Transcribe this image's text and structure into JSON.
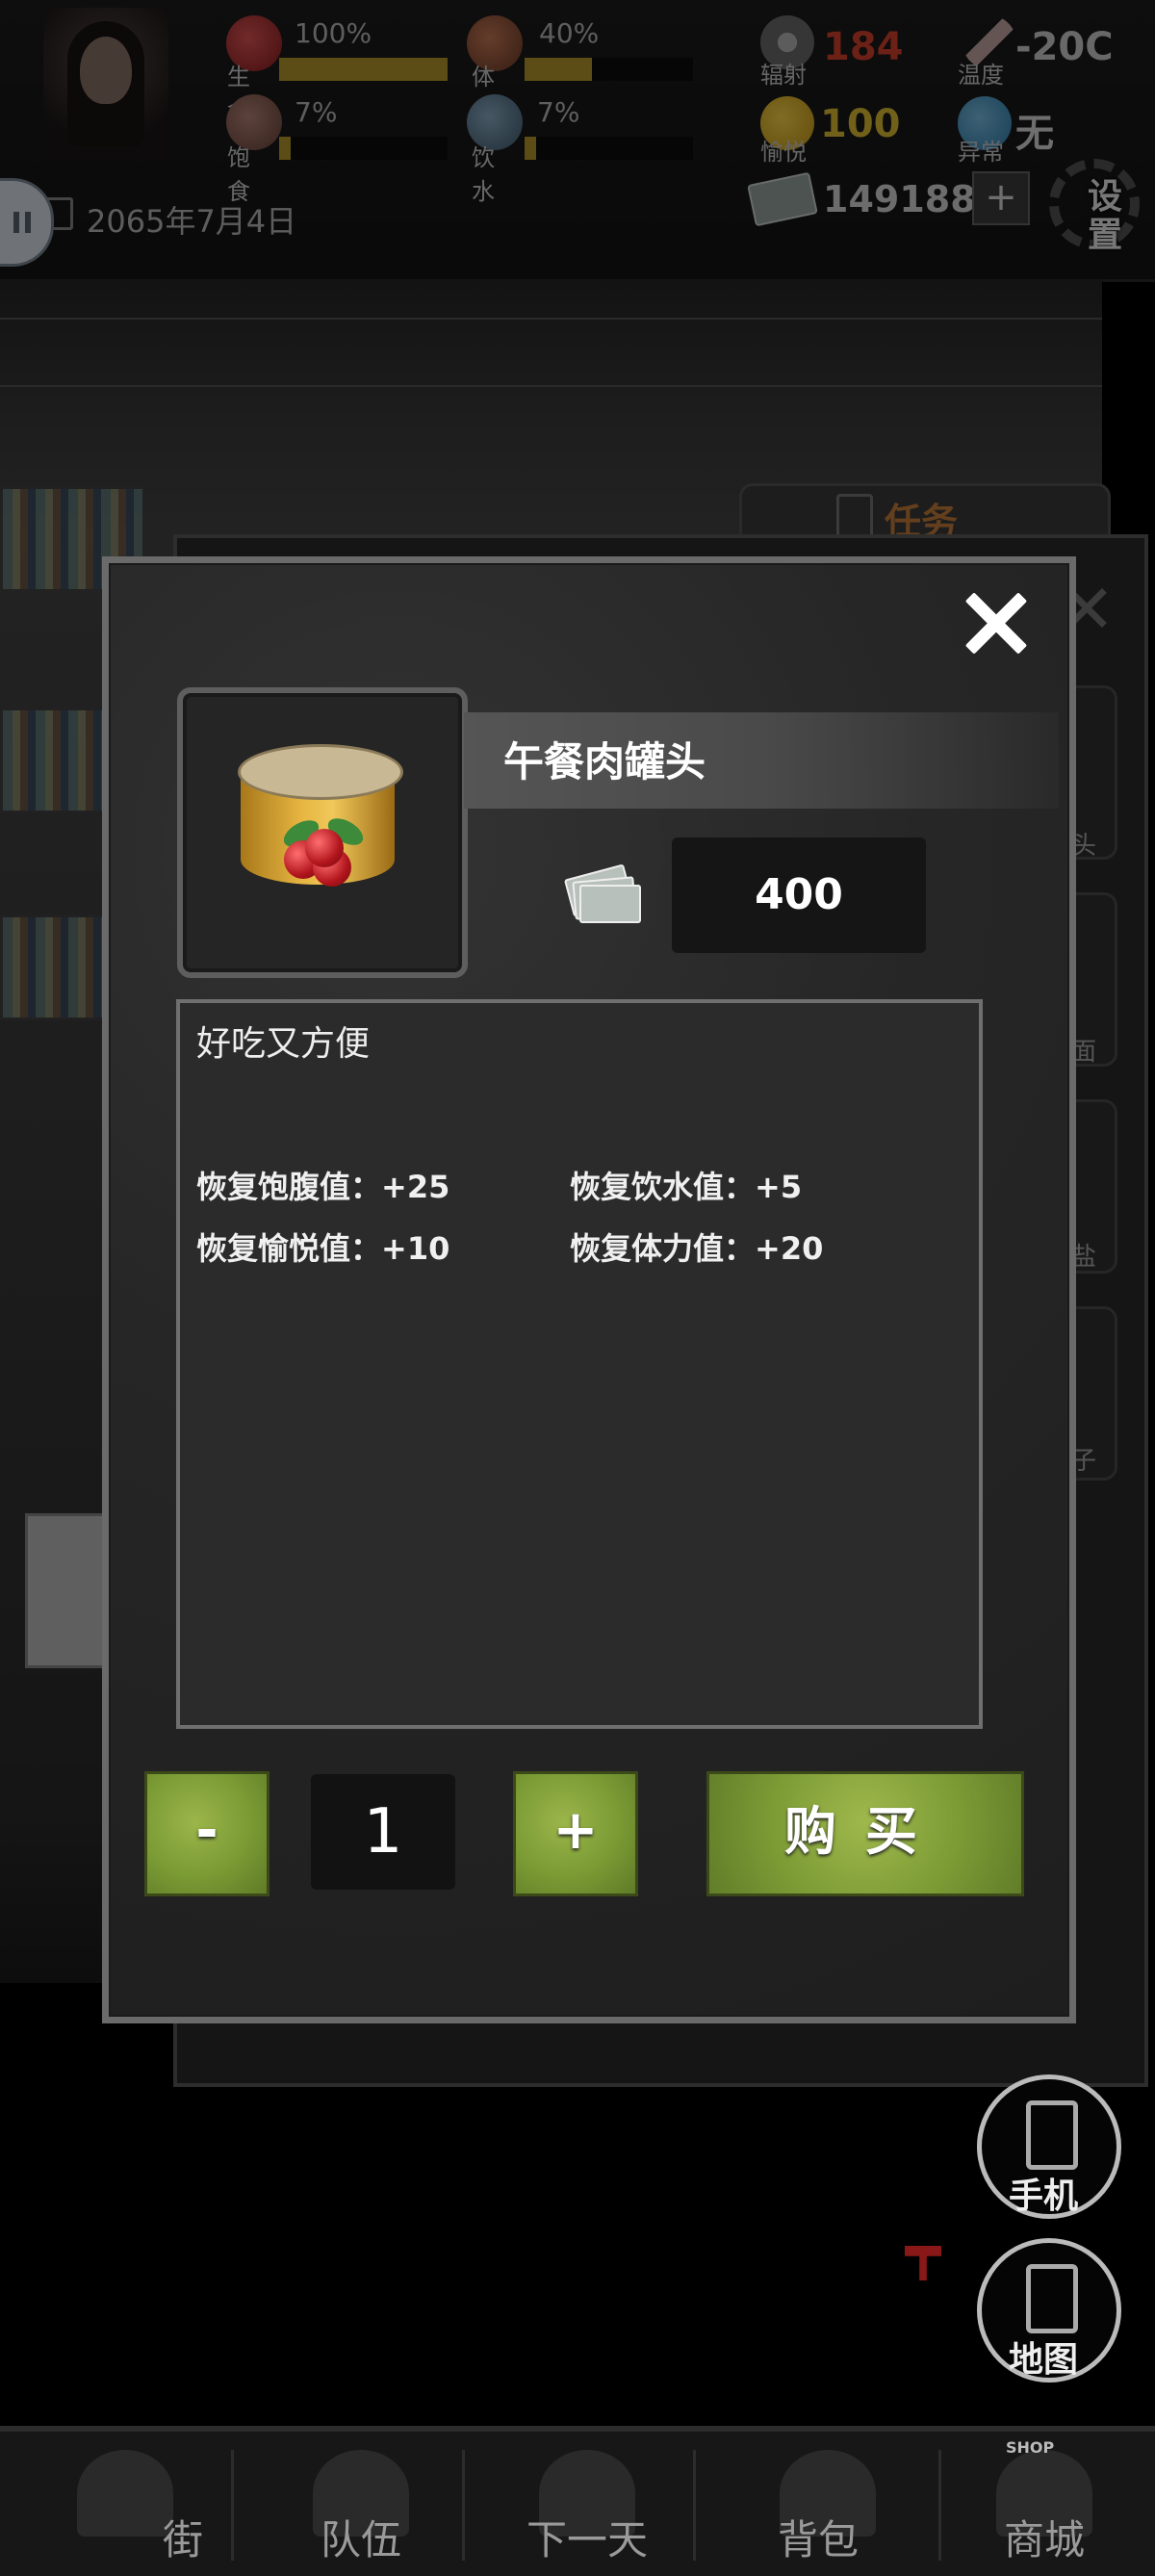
{
  "hud": {
    "stats": [
      {
        "label": "生命",
        "value": "100%",
        "fill": 1.0,
        "icon": "heart-icon",
        "color": "#c0383a"
      },
      {
        "label": "体力",
        "value": "40%",
        "fill": 0.4,
        "icon": "muscle-icon",
        "color": "#a35a3a"
      },
      {
        "label": "饱食",
        "value": "7%",
        "fill": 0.07,
        "icon": "stomach-icon",
        "color": "#9a6a55"
      },
      {
        "label": "饮水",
        "value": "7%",
        "fill": 0.07,
        "icon": "water-drop-icon",
        "color": "#5f7d92"
      }
    ],
    "radiation": {
      "label": "辐射",
      "value": "184",
      "color": "#d9432c"
    },
    "temperature": {
      "label": "温度",
      "value": "-20C"
    },
    "joy": {
      "label": "愉悦",
      "value": "100",
      "color": "#e3c033"
    },
    "abnormal": {
      "label": "异常",
      "value": "无"
    },
    "date": "2065年7月4日",
    "money": "1491881",
    "money_add": "+",
    "settings": "设置"
  },
  "background": {
    "task_tab": "任务",
    "item_labels": [
      "头",
      "面",
      "盐",
      "子"
    ]
  },
  "modal": {
    "item_name": "午餐肉罐头",
    "price": "400",
    "description": "好吃又方便",
    "effects": [
      "恢复饱腹值：+25",
      "恢复饮水值：+5",
      "恢复愉悦值：+10",
      "恢复体力值：+20"
    ],
    "minus": "-",
    "quantity": "1",
    "plus": "+",
    "buy": "购买"
  },
  "side_buttons": {
    "phone": "手机",
    "map": "地图"
  },
  "nav": [
    {
      "label": "街",
      "icon": "lock-icon"
    },
    {
      "label": "队伍",
      "icon": "team-icon"
    },
    {
      "label": "下一天",
      "icon": "book-icon"
    },
    {
      "label": "背包",
      "icon": "house-icon"
    },
    {
      "label": "商城",
      "icon": "shop-icon",
      "badge": "SHOP"
    }
  ]
}
